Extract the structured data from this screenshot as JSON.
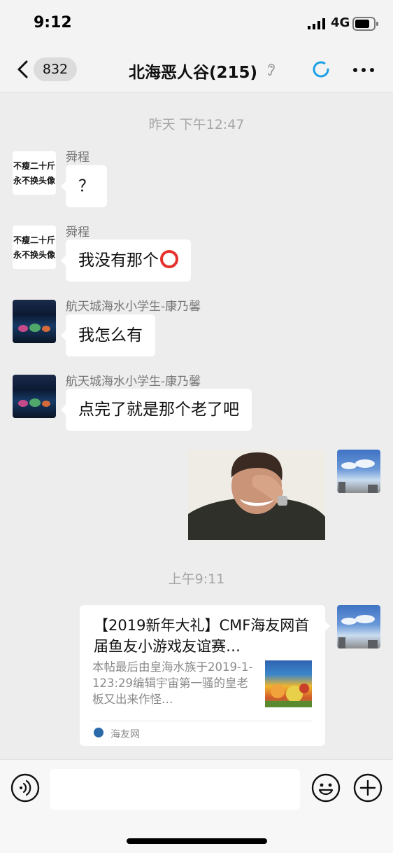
{
  "status_bar": {
    "time": "9:12",
    "network": "4G"
  },
  "nav": {
    "back_count": "832",
    "title": "北海恶人谷(215)",
    "icons": [
      "back-icon",
      "ear-icon",
      "loading-icon",
      "more-icon"
    ]
  },
  "timestamps": [
    "昨天 下午12:47",
    "上午9:11"
  ],
  "messages": [
    {
      "sender": "舜程",
      "avatar_text": [
        "不瘦二十斤",
        "永不换头像"
      ],
      "text": "？"
    },
    {
      "sender": "舜程",
      "avatar_text": [
        "不瘦二十斤",
        "永不换头像"
      ],
      "text": "我没有那个"
    },
    {
      "sender": "航天城海水小学生-康乃馨",
      "text": "我怎么有"
    },
    {
      "sender": "航天城海水小学生-康乃馨",
      "text": "点完了就是那个老了吧"
    }
  ],
  "link_card": {
    "title": "【2019新年大礼】CMF海友网首届鱼友小游戏友谊赛…",
    "description": "本帖最后由皇海水族于2019-1-123:29编辑宇宙第一骚的皇老板又出来作怪…",
    "source": "海友网"
  },
  "input_bar": {
    "placeholder": "",
    "icons": [
      "voice-icon",
      "emoji-icon",
      "plus-icon"
    ]
  },
  "colors": {
    "background": "#ededed",
    "bubble": "#ffffff",
    "accent_blue": "#1aa0e8",
    "red_circle": "#e5322d"
  }
}
